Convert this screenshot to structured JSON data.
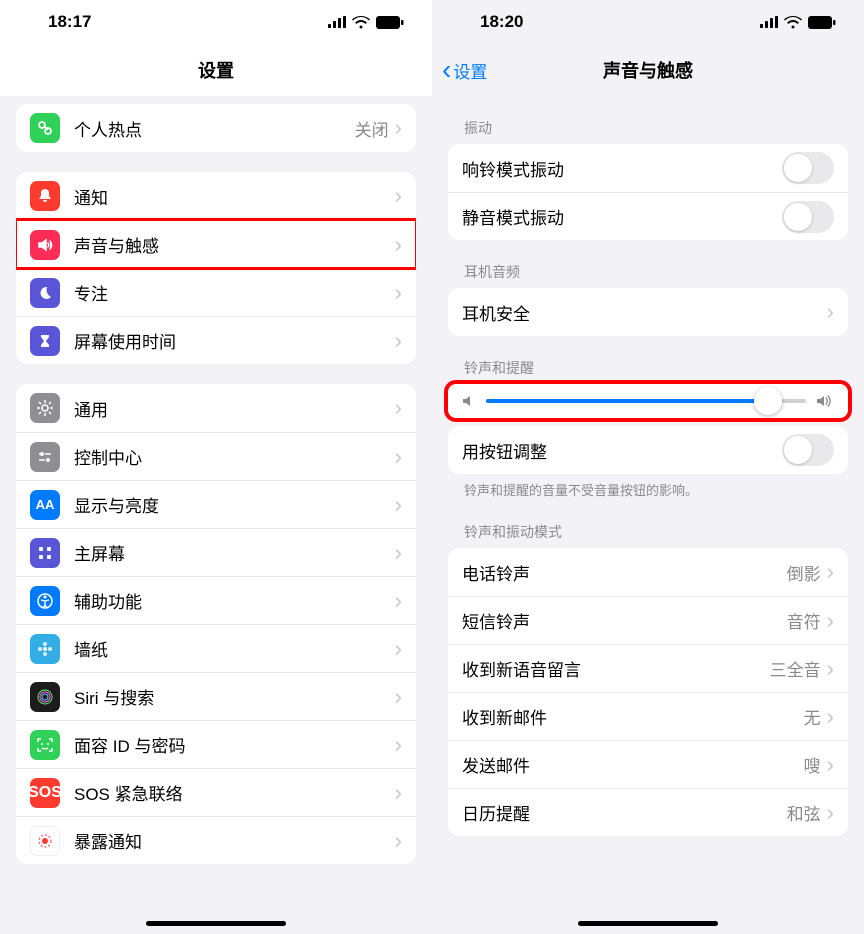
{
  "left": {
    "time": "18:17",
    "title": "设置",
    "rows": {
      "hotspot": {
        "label": "个人热点",
        "value": "关闭"
      },
      "notify": {
        "label": "通知"
      },
      "sound": {
        "label": "声音与触感"
      },
      "focus": {
        "label": "专注"
      },
      "screentime": {
        "label": "屏幕使用时间"
      },
      "general": {
        "label": "通用"
      },
      "control": {
        "label": "控制中心"
      },
      "display": {
        "label": "显示与亮度"
      },
      "home": {
        "label": "主屏幕"
      },
      "access": {
        "label": "辅助功能"
      },
      "wallpaper": {
        "label": "墙纸"
      },
      "siri": {
        "label": "Siri 与搜索"
      },
      "faceid": {
        "label": "面容 ID 与密码"
      },
      "sos": {
        "label": "SOS 紧急联络",
        "icon_text": "SOS"
      },
      "exposure": {
        "label": "暴露通知"
      }
    }
  },
  "right": {
    "time": "18:20",
    "back": "设置",
    "title": "声音与触感",
    "sections": {
      "vibration": "振动",
      "headphone": "耳机音频",
      "ringer": "铃声和提醒",
      "pattern": "铃声和振动模式"
    },
    "rows": {
      "ring_vib": {
        "label": "响铃模式振动"
      },
      "silent_vib": {
        "label": "静音模式振动"
      },
      "headphone_safety": {
        "label": "耳机安全"
      },
      "button_adjust": {
        "label": "用按钮调整"
      },
      "ringtone": {
        "label": "电话铃声",
        "value": "倒影"
      },
      "text": {
        "label": "短信铃声",
        "value": "音符"
      },
      "voicemail": {
        "label": "收到新语音留言",
        "value": "三全音"
      },
      "mail": {
        "label": "收到新邮件",
        "value": "无"
      },
      "sent": {
        "label": "发送邮件",
        "value": "嗖"
      },
      "calendar": {
        "label": "日历提醒",
        "value": "和弦"
      }
    },
    "footer": "铃声和提醒的音量不受音量按钮的影响。",
    "slider_percent": 88
  }
}
